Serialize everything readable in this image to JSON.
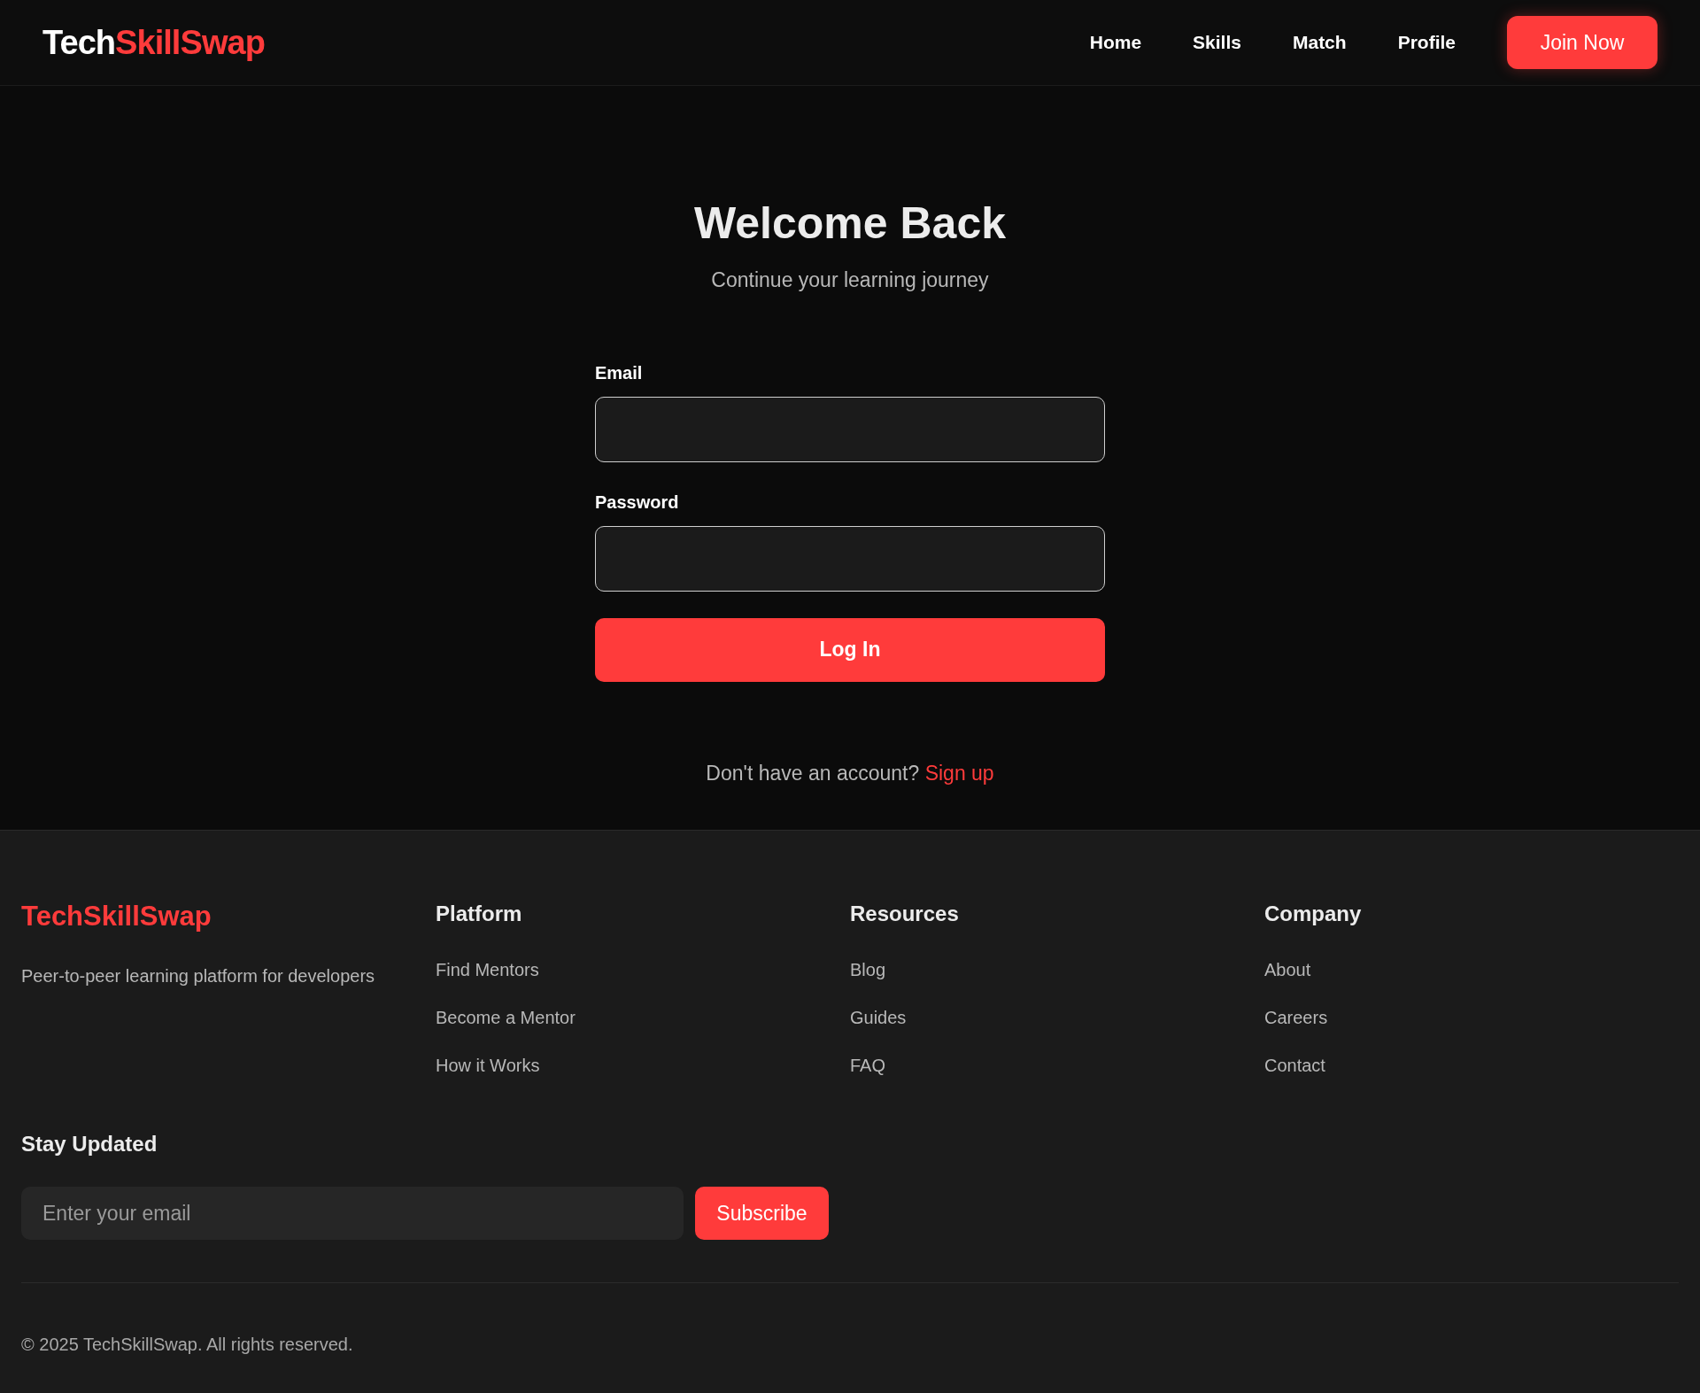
{
  "header": {
    "logo": {
      "part_1": "Tech",
      "part_2": "SkillSwap"
    },
    "nav": [
      "Home",
      "Skills",
      "Match",
      "Profile"
    ],
    "cta": "Join Now"
  },
  "login": {
    "title": "Welcome Back",
    "subtitle": "Continue your learning journey",
    "fields": [
      {
        "label": "Email"
      },
      {
        "label": "Password"
      }
    ],
    "submit": "Log In",
    "signup_prompt": "Don't have an account?",
    "signup_link": "Sign up"
  },
  "footer": {
    "brand": "TechSkillSwap",
    "tagline": "Peer-to-peer learning platform for developers",
    "columns": [
      {
        "title": "Platform",
        "links": [
          "Find Mentors",
          "Become a Mentor",
          "How it Works"
        ]
      },
      {
        "title": "Resources",
        "links": [
          "Blog",
          "Guides",
          "FAQ"
        ]
      },
      {
        "title": "Company",
        "links": [
          "About",
          "Careers",
          "Contact"
        ]
      }
    ],
    "newsletter": {
      "title": "Stay Updated",
      "placeholder": "Enter your email",
      "button": "Subscribe"
    },
    "copyright": "© 2025 TechSkillSwap. All rights reserved."
  }
}
